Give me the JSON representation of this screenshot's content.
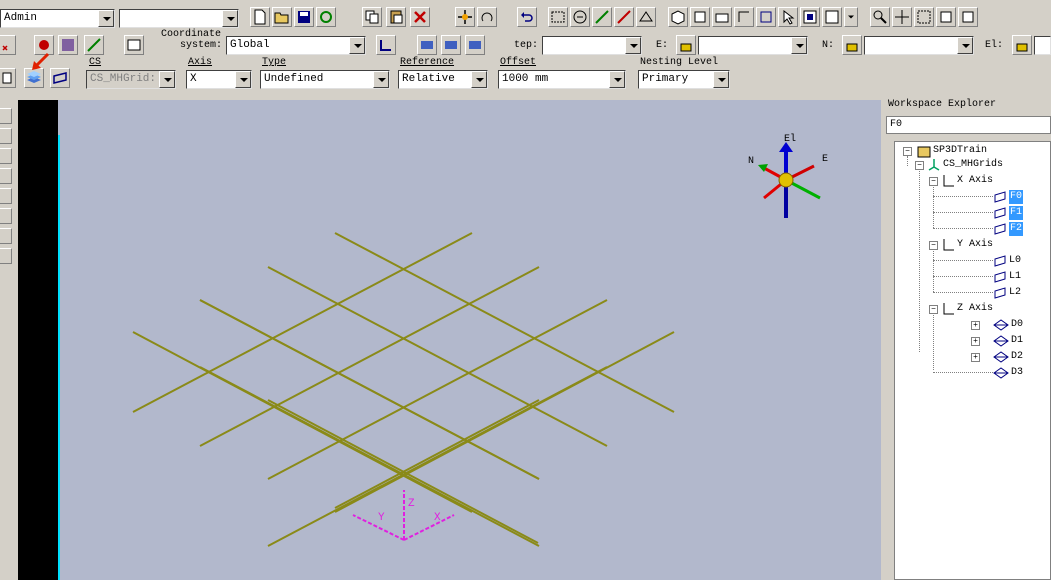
{
  "toolbar_row1": {
    "user_combo": "Admin",
    "filter_combo": ""
  },
  "toolbar_row2": {
    "coord_label_line1": "Coordinate",
    "coord_label_line2": "system:",
    "coord_value": "Global",
    "step_label": "tep:",
    "step_value": "",
    "e_label": "E:",
    "e_value": "",
    "n_label": "N:",
    "n_value": "",
    "el_label": "El:",
    "el_value": ""
  },
  "toolbar_row3": {
    "cs_label": "CS",
    "cs_value": "CS_MHGrid:",
    "axis_label": "Axis",
    "axis_value": "X",
    "type_label": "Type",
    "type_value": "Undefined",
    "reference_label": "Reference",
    "reference_value": "Relative",
    "offset_label": "Offset",
    "offset_value": "1000 mm",
    "nesting_label": "Nesting Level",
    "nesting_value": "Primary"
  },
  "viewport": {
    "compass": {
      "up": "El",
      "north": "N",
      "east": "E"
    },
    "origin_axes": {
      "x": "X",
      "y": "Y",
      "z": "Z"
    }
  },
  "explorer": {
    "title": "Workspace Explorer",
    "filter_value": "F0",
    "tree": {
      "root": "SP3DTrain",
      "cs": "CS_MHGrids",
      "x_axis": "X Axis",
      "x_items": [
        "F0",
        "F1",
        "F2"
      ],
      "y_axis": "Y Axis",
      "y_items": [
        "L0",
        "L1",
        "L2"
      ],
      "z_axis": "Z Axis",
      "z_items": [
        "D0",
        "D1",
        "D2",
        "D3"
      ]
    }
  },
  "colors": {
    "viewport_bg": "#b2b8cc",
    "grid_line": "#8a8a18",
    "selection": "#3399ff",
    "axis_magenta": "#e020e0"
  }
}
